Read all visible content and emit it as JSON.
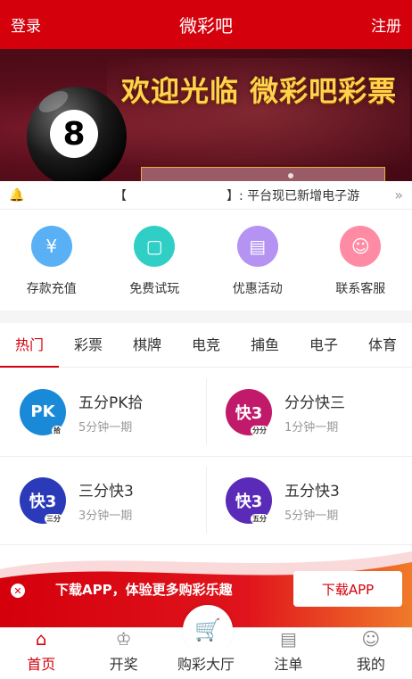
{
  "header": {
    "left": "登录",
    "title": "微彩吧",
    "right": "注册"
  },
  "banner": {
    "welcome": "欢迎光临 微彩吧彩票",
    "ball_number": "8"
  },
  "notice": {
    "text": "【　　　　　　　　】: 平台现已新增电子游"
  },
  "quick": [
    {
      "label": "存款充值",
      "icon": "deposit-icon",
      "color": "#5ab0f5",
      "glyph": "¥"
    },
    {
      "label": "免费试玩",
      "icon": "free-play-icon",
      "color": "#2fcfc6",
      "glyph": "▢"
    },
    {
      "label": "优惠活动",
      "icon": "promotion-icon",
      "color": "#b493f2",
      "glyph": "▤"
    },
    {
      "label": "联系客服",
      "icon": "customer-service-icon",
      "color": "#ff8aa3",
      "glyph": "☺"
    }
  ],
  "tabs": [
    "热门",
    "彩票",
    "棋牌",
    "电竞",
    "捕鱼",
    "电子",
    "体育"
  ],
  "games": [
    {
      "name": "五分PK拾",
      "period": "5分钟一期",
      "icon_text": "PK",
      "icon_sub": "拾",
      "color": "#1a8ad8"
    },
    {
      "name": "分分快三",
      "period": "1分钟一期",
      "icon_text": "快3",
      "icon_sub": "分分",
      "color": "#c21a6a"
    },
    {
      "name": "三分快3",
      "period": "3分钟一期",
      "icon_text": "快3",
      "icon_sub": "三分",
      "color": "#2a3ab8"
    },
    {
      "name": "五分快3",
      "period": "5分钟一期",
      "icon_text": "快3",
      "icon_sub": "五分",
      "color": "#5a2ab8"
    }
  ],
  "download": {
    "message": "下载APP，体验更多购彩乐趣",
    "button": "下载APP",
    "close": "✕"
  },
  "tabbar": [
    {
      "label": "首页",
      "icon": "home-icon",
      "glyph": "⌂",
      "active": true
    },
    {
      "label": "开奖",
      "icon": "trophy-icon",
      "glyph": "♔",
      "active": false
    },
    {
      "label": "购彩大厅",
      "icon": "cart-icon",
      "glyph": "",
      "active": false
    },
    {
      "label": "注单",
      "icon": "clipboard-icon",
      "glyph": "▤",
      "active": false
    },
    {
      "label": "我的",
      "icon": "user-icon",
      "glyph": "☺",
      "active": false
    }
  ],
  "colors": {
    "primary": "#d4000c"
  }
}
